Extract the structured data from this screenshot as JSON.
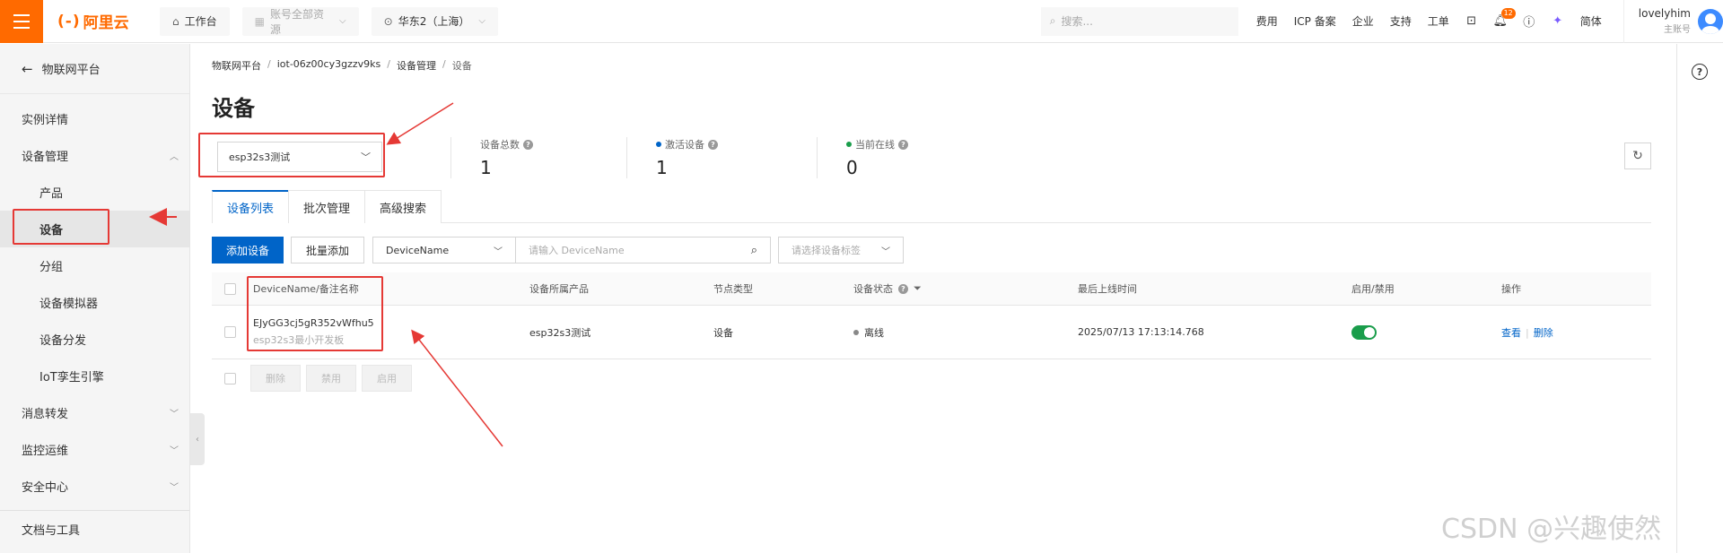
{
  "topbar": {
    "logo_mark": "(-)",
    "logo_text": "阿里云",
    "workbench": "工作台",
    "account_resources": "账号全部资源",
    "region": "华东2（上海）",
    "search_placeholder": "搜索...",
    "links": [
      "费用",
      "ICP 备案",
      "企业",
      "支持",
      "工单"
    ],
    "notification_count": "12",
    "language": "简体",
    "username": "lovelyhim",
    "user_role": "主账号"
  },
  "sidebar": {
    "back_label": "物联网平台",
    "items": [
      {
        "label": "实例详情",
        "level": 0
      },
      {
        "label": "设备管理",
        "level": 0,
        "expanded": true
      },
      {
        "label": "产品",
        "level": 1
      },
      {
        "label": "设备",
        "level": 1,
        "active": true
      },
      {
        "label": "分组",
        "level": 1
      },
      {
        "label": "设备模拟器",
        "level": 1
      },
      {
        "label": "设备分发",
        "level": 1
      },
      {
        "label": "IoT孪生引擎",
        "level": 1
      },
      {
        "label": "消息转发",
        "level": 0
      },
      {
        "label": "监控运维",
        "level": 0
      },
      {
        "label": "安全中心",
        "level": 0
      },
      {
        "label": "文档与工具",
        "level": 0
      }
    ]
  },
  "breadcrumb": [
    "物联网平台",
    "iot-06z00cy3gzzv9ks",
    "设备管理",
    "设备"
  ],
  "page_title": "设备",
  "product_select": "esp32s3测试",
  "stats": [
    {
      "label": "设备总数",
      "value": "1"
    },
    {
      "label": "激活设备",
      "value": "1",
      "dot": "#0064c8"
    },
    {
      "label": "当前在线",
      "value": "0",
      "dot": "#1a9d4b"
    }
  ],
  "tabs": [
    "设备列表",
    "批次管理",
    "高级搜索"
  ],
  "toolbar": {
    "add_device": "添加设备",
    "batch_add": "批量添加",
    "filter_field": "DeviceName",
    "filter_placeholder": "请输入 DeviceName",
    "tag_placeholder": "请选择设备标签"
  },
  "table": {
    "headers": [
      "DeviceName/备注名称",
      "设备所属产品",
      "节点类型",
      "设备状态",
      "最后上线时间",
      "启用/禁用",
      "操作"
    ],
    "rows": [
      {
        "device_name": "EJyGG3cj5gR352vWfhu5",
        "remark": "esp32s3最小开发板",
        "product": "esp32s3测试",
        "node_type": "设备",
        "status": "离线",
        "last_online": "2025/07/13 17:13:14.768",
        "enabled": true,
        "action_view": "查看",
        "action_delete": "删除"
      }
    ]
  },
  "bulk_actions": [
    "删除",
    "禁用",
    "启用"
  ],
  "watermark": "CSDN @兴趣使然",
  "colors": {
    "brand": "#ff6a00",
    "primary": "#0064c8",
    "annotation": "#e53935",
    "online": "#1a9d4b"
  }
}
